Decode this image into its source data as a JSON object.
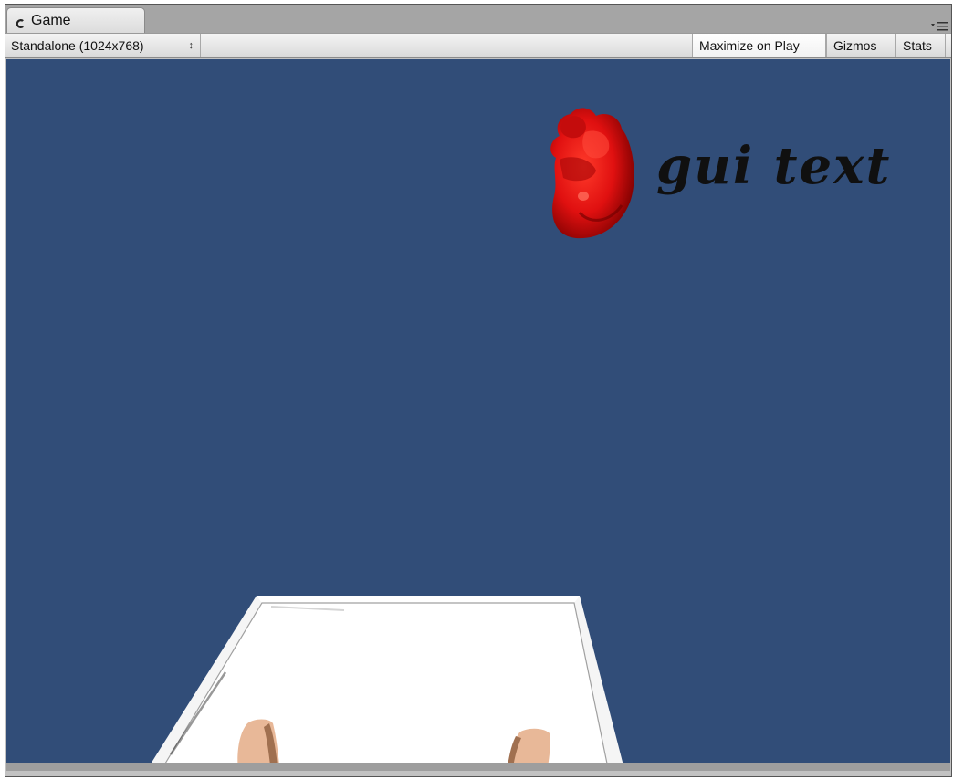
{
  "window": {
    "tab_title": "Game",
    "tab_icon": "unity-game-icon",
    "panel_menu_icon": "panel-menu-icon"
  },
  "toolbar": {
    "resolution": "Standalone (1024x768)",
    "resolution_arrows": "↕",
    "maximize_on_play": "Maximize on Play",
    "gizmos": "Gizmos",
    "stats": "Stats"
  },
  "scene": {
    "background_color": "#314d78",
    "gui_text": "gui text",
    "heart_color": "#e01010",
    "table_color": "#ffffff",
    "hand_color": "#e8b898"
  }
}
